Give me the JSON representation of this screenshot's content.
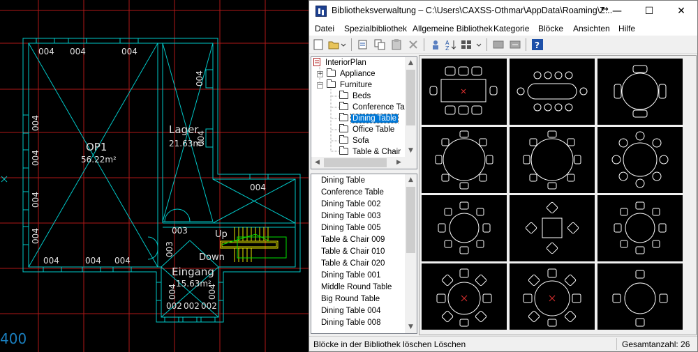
{
  "cad": {
    "rooms": [
      {
        "name": "OP1",
        "area": "56.22m²"
      },
      {
        "name": "Lager",
        "area": "21.63m²"
      },
      {
        "name": "Eingang",
        "area": "15.63m²"
      }
    ],
    "window_tags": {
      "t004": "004",
      "t003": "003",
      "t002": "002"
    },
    "stair_labels": {
      "up": "Up",
      "down": "Down"
    },
    "ruler_value": "400"
  },
  "window": {
    "title": "Bibliotheksverwaltung – C:\\Users\\CAXSS-Othmar\\AppData\\Roaming\\Z...",
    "minimize_glyph": "—",
    "maximize_glyph": "☐",
    "close_glyph": "✕",
    "resize_glyph": "↔"
  },
  "menu": [
    "Datei",
    "Spezialbibliothek",
    "Allgemeine Bibliothek",
    "Kategorie",
    "Blöcke",
    "Ansichten",
    "Hilfe"
  ],
  "toolbar_icons": [
    "new-icon",
    "open-folder-icon",
    "insert-block-icon",
    "copy-icon",
    "paste-icon",
    "delete-icon",
    "properties-icon",
    "sort-icon",
    "view-grid-icon",
    "import-icon",
    "export-icon",
    "help-icon"
  ],
  "tree": {
    "root": "InteriorPlan",
    "items": [
      {
        "label": "Appliance",
        "level": 1,
        "expander": "+"
      },
      {
        "label": "Furniture",
        "level": 1,
        "expander": "−"
      },
      {
        "label": "Beds",
        "level": 2
      },
      {
        "label": "Conference Tab",
        "level": 2
      },
      {
        "label": "Dining Table",
        "level": 2,
        "selected": true
      },
      {
        "label": "Office Table",
        "level": 2
      },
      {
        "label": "Sofa",
        "level": 2
      },
      {
        "label": "Table & Chair",
        "level": 2
      }
    ]
  },
  "blocks": [
    "Dining Table",
    "Conference Table",
    "Dining Table 002",
    "Dining Table 003",
    "Dining Table 005",
    "Table & Chair 009",
    "Table & Chair 010",
    "Table & Chair 020",
    "Dining Table 001",
    "Middle Round Table",
    "Big Round Table",
    "Dining Table 004",
    "Dining Table 008"
  ],
  "status": {
    "left": "Blöcke in der Bibliothek löschen Löschen",
    "right": "Gesamtanzahl: 26"
  },
  "colors": {
    "cad_wall": "#00c8c8",
    "cad_grid": "#b01818",
    "stair": "#e8e800",
    "selection": "#0078d7"
  }
}
